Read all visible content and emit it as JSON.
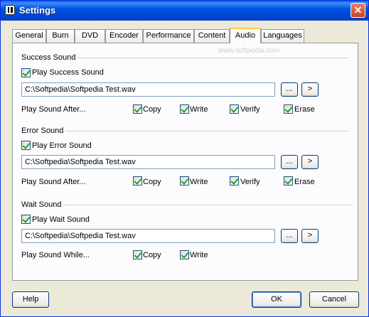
{
  "window": {
    "title": "Settings",
    "close_label": "✕"
  },
  "tabs": [
    {
      "label": "General"
    },
    {
      "label": "Burn"
    },
    {
      "label": "DVD"
    },
    {
      "label": "Encoder"
    },
    {
      "label": "Performance"
    },
    {
      "label": "Content"
    },
    {
      "label": "Audio",
      "active": true
    },
    {
      "label": "Languages"
    }
  ],
  "watermark": "www.softpedia.com",
  "success": {
    "group_title": "Success Sound",
    "enable_label": "Play Success Sound",
    "enable_checked": true,
    "file_path": "C:\\Softpedia\\Softpedia Test.wav",
    "browse_label": "...",
    "play_label": ">",
    "after_label": "Play Sound After...",
    "options": [
      {
        "label": "Copy",
        "checked": true
      },
      {
        "label": "Write",
        "checked": true
      },
      {
        "label": "Verify",
        "checked": true
      },
      {
        "label": "Erase",
        "checked": true
      }
    ]
  },
  "error": {
    "group_title": "Error Sound",
    "enable_label": "Play Error Sound",
    "enable_checked": true,
    "file_path": "C:\\Softpedia\\Softpedia Test.wav",
    "browse_label": "...",
    "play_label": ">",
    "after_label": "Play Sound After...",
    "options": [
      {
        "label": "Copy",
        "checked": true
      },
      {
        "label": "Write",
        "checked": true
      },
      {
        "label": "Verify",
        "checked": true
      },
      {
        "label": "Erase",
        "checked": true
      }
    ]
  },
  "wait": {
    "group_title": "Wait Sound",
    "enable_label": "Play Wait Sound",
    "enable_checked": true,
    "file_path": "C:\\Softpedia\\Softpedia Test.wav",
    "browse_label": "...",
    "play_label": ">",
    "while_label": "Play Sound While...",
    "options": [
      {
        "label": "Copy",
        "checked": true
      },
      {
        "label": "Write",
        "checked": true
      }
    ]
  },
  "buttons": {
    "help": "Help",
    "ok": "OK",
    "cancel": "Cancel"
  }
}
